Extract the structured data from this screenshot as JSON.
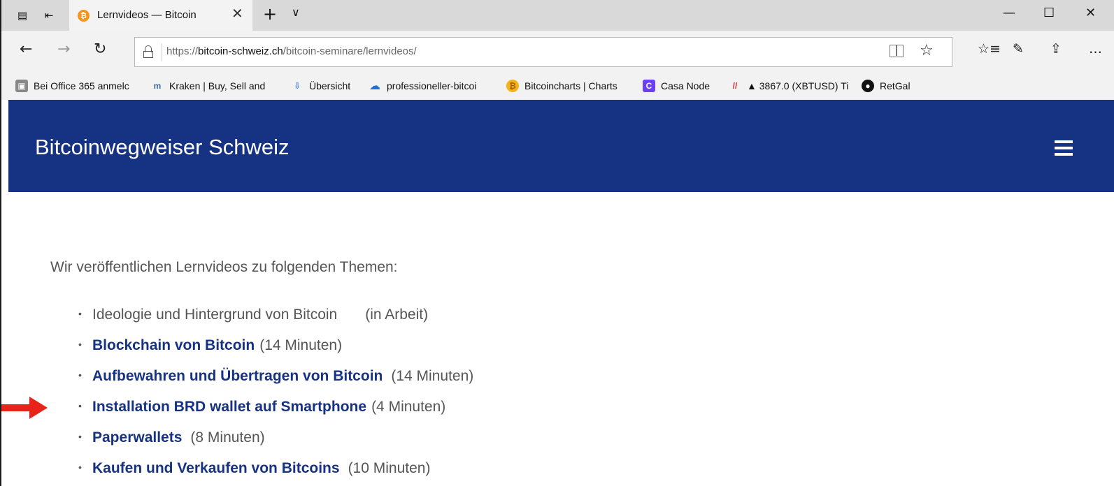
{
  "browser": {
    "tab": {
      "title": "Lernvideos — Bitcoin",
      "favicon": "₿"
    },
    "window_controls": {
      "minimize": "—",
      "maximize": "☐",
      "close": "✕"
    },
    "address": {
      "url_scheme": "https://",
      "url_domain": "bitcoin-schweiz.ch",
      "url_path": "/bitcoin-seminare/lernvideos/"
    },
    "favorites": [
      {
        "label": "Bei Office 365 anmelc",
        "icon": "office-icon"
      },
      {
        "label": "Kraken | Buy, Sell and",
        "icon": "kraken-icon"
      },
      {
        "label": "Übersicht",
        "icon": "overview-icon"
      },
      {
        "label": "professioneller-bitcoi",
        "icon": "cloud-icon"
      },
      {
        "label": "Bitcoincharts | Charts",
        "icon": "bitcoincharts-icon"
      },
      {
        "label": "Casa Node",
        "icon": "casa-icon"
      },
      {
        "label": "▲ 3867.0 (XBTUSD) Ti",
        "icon": "bitmex-icon"
      },
      {
        "label": "RetGal",
        "icon": "github-icon"
      }
    ]
  },
  "site": {
    "title": "Bitcoinwegweiser Schweiz",
    "intro": "Wir veröffentlichen Lernvideos zu folgenden Themen:",
    "topics": [
      {
        "link": "",
        "text": "Ideologie und Hintergrund von Bitcoin",
        "duration": "(in Arbeit)"
      },
      {
        "link": "Blockchain von Bitcoin",
        "text": "",
        "duration": "(14 Minuten)"
      },
      {
        "link": "Aufbewahren und Übertragen von Bitcoin",
        "text": "",
        "duration": "(14 Minuten)"
      },
      {
        "link": "Installation BRD wallet auf Smartphone",
        "text": "",
        "duration": "(4 Minuten)"
      },
      {
        "link": "Paperwallets",
        "text": "",
        "duration": "(8 Minuten)"
      },
      {
        "link": "Kaufen und Verkaufen von Bitcoins",
        "text": "",
        "duration": "(10 Minuten)"
      }
    ]
  },
  "colors": {
    "header_bg": "#163383",
    "link": "#163383",
    "body_text": "#555555",
    "annotation_arrow": "#e8231a"
  }
}
